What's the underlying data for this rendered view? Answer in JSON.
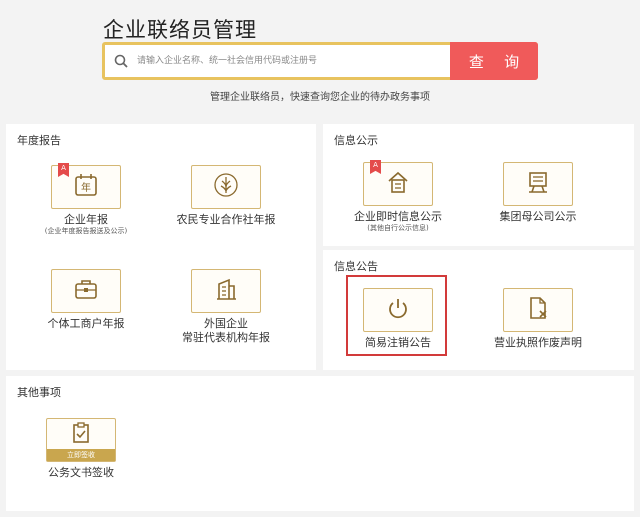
{
  "header": {
    "title": "企业联络员管理",
    "search_placeholder": "请输入企业名称、统一社会信用代码或注册号",
    "search_button": "查 询",
    "subtitle": "管理企业联络员，快速查询您企业的待办政务事项"
  },
  "annual_report": {
    "title": "年度报告",
    "items": [
      {
        "label": "企业年报",
        "note": "(企业年度报告报送及公示)",
        "icon": "calendar-year-icon",
        "badge": "A"
      },
      {
        "label": "农民专业合作社年报",
        "icon": "wheat-emblem-icon"
      },
      {
        "label": "个体工商户年报",
        "icon": "briefcase-icon"
      },
      {
        "label": "外国企业",
        "label2": "常驻代表机构年报",
        "icon": "building-document-icon"
      }
    ]
  },
  "info_public": {
    "title": "信息公示",
    "items": [
      {
        "label": "企业即时信息公示",
        "note": "(其他自行公示信息)",
        "icon": "house-document-icon",
        "badge": "A"
      },
      {
        "label": "集团母公司公示",
        "icon": "flag-board-icon"
      }
    ]
  },
  "info_notice": {
    "title": "信息公告",
    "items": [
      {
        "label": "简易注销公告",
        "icon": "power-icon"
      },
      {
        "label": "营业执照作废声明",
        "icon": "document-cancel-icon"
      }
    ]
  },
  "other": {
    "title": "其他事项",
    "items": [
      {
        "label": "公务文书签收",
        "band": "立即签收",
        "icon": "clipboard-check-icon"
      }
    ]
  },
  "colors": {
    "accent_gold": "#c9a64e",
    "search_red": "#f05a5a",
    "highlight_red": "#d23a3a"
  }
}
